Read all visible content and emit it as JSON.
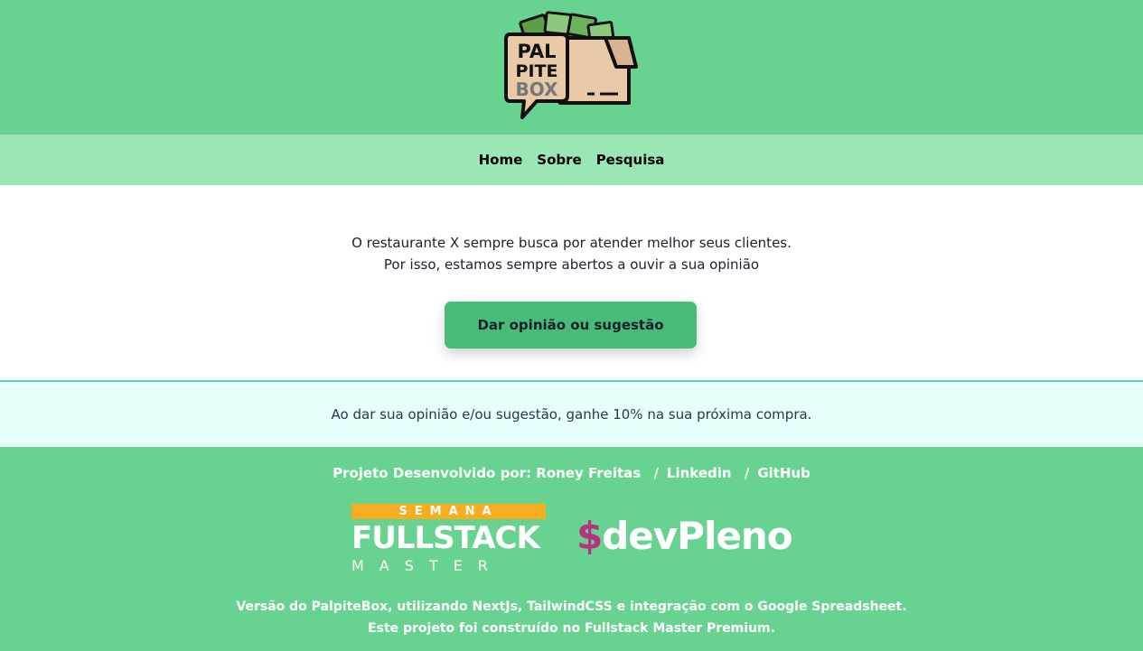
{
  "header": {
    "logo": {
      "line1": "PAL",
      "line2": "PITE",
      "line3": "BOX"
    }
  },
  "nav": {
    "items": [
      "Home",
      "Sobre",
      "Pesquisa"
    ]
  },
  "main": {
    "intro_line1": "O restaurante X sempre busca por atender melhor seus clientes.",
    "intro_line2": "Por isso, estamos sempre abertos a ouvir a sua opinião",
    "cta_label": "Dar opinião ou sugestão"
  },
  "notice": {
    "text": "Ao dar sua opinião e/ou sugestão, ganhe 10% na sua próxima compra."
  },
  "footer": {
    "credits_prefix": "Projeto Desenvolvido por:",
    "author": "Roney Freitas",
    "sep": "/",
    "linkedin": "Linkedin",
    "github": "GitHub",
    "fullstack_logo": {
      "semana": "SEMANA",
      "fullstack": "FULLSTACK",
      "master": "MASTER"
    },
    "devpleno_logo": {
      "dollar": "$",
      "name": "devPleno"
    },
    "version_line1": "Versão do PalpiteBox, utilizando NextJs, TailwindCSS e integração com o Google Spreadsheet.",
    "version_line2": "Este projeto foi construído no Fullstack Master Premium."
  },
  "colors": {
    "header_bg": "#68d391",
    "nav_bg": "#9ae6b4",
    "button_bg": "#48bb78",
    "notice_bg": "#e6fffa",
    "notice_border": "#4fd1c5",
    "semana_bar": "#f6ad20",
    "devpleno_dollar": "#b83280"
  }
}
